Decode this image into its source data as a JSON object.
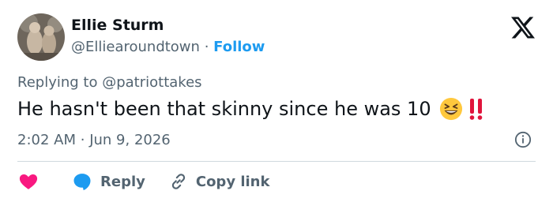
{
  "author": {
    "display_name": "Ellie Sturm",
    "handle": "@Elliearoundtown",
    "separator": "·",
    "follow_label": "Follow"
  },
  "reply": {
    "prefix": "Replying to",
    "handle": "@patriottakes"
  },
  "tweet": {
    "text": "He hasn't been that skinny since he was 10",
    "emoji": [
      "grinning-squinting-face",
      "double-exclamation-mark"
    ]
  },
  "meta": {
    "time": "2:02 AM",
    "separator": "·",
    "date": "Jun 9, 2026"
  },
  "actions": {
    "reply_label": "Reply",
    "copy_link_label": "Copy link"
  },
  "colors": {
    "accent": "#1d9bf0",
    "like": "#f91880",
    "text": "#0f1419",
    "muted": "#536471",
    "divider": "#cfd9de"
  }
}
